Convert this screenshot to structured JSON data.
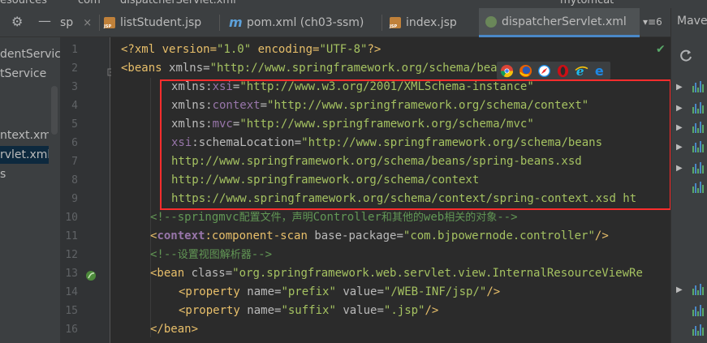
{
  "breadcrumb": {
    "a": "esources",
    "b": "com",
    "c": "dispatcherServlet.xml",
    "run_config": "mytomcat"
  },
  "tabs": [
    {
      "label": "sp",
      "icon": "jsp-file-icon"
    },
    {
      "label": "listStudent.jsp",
      "icon": "jsp-file-icon"
    },
    {
      "label": "pom.xml (ch03-ssm)",
      "icon": "maven-icon"
    },
    {
      "label": "index.jsp",
      "icon": "jsp-file-icon"
    },
    {
      "label": "dispatcherServlet.xml",
      "icon": "xml-file-icon",
      "active": true
    }
  ],
  "tab_overflow": "▾≡6",
  "maven_label": "Mave",
  "project": {
    "items": [
      {
        "label": "dentService"
      },
      {
        "label": "tService"
      },
      {
        "label": "ntext.xml"
      },
      {
        "label": "rvlet.xml",
        "selected": true
      },
      {
        "label": "s"
      }
    ]
  },
  "line_numbers": [
    "1",
    "2",
    "3",
    "4",
    "5",
    "6",
    "7",
    "8",
    "9",
    "10",
    "11",
    "12",
    "13",
    "14",
    "15",
    "16"
  ],
  "code": {
    "l1": {
      "a": "<?xml version=",
      "b": "\"1.0\"",
      "c": " encoding=",
      "d": "\"UTF-8\"",
      "e": "?>"
    },
    "l2": {
      "a": "<beans ",
      "b": "xmlns=",
      "c": "\"http://www.springframework.org/schema/bea"
    },
    "l3": {
      "ns": "xmlns:",
      "ns2": "xsi",
      "eq": "=",
      "val": "\"http://www.w3.org/2001/XMLSchema-instance\""
    },
    "l4": {
      "ns": "xmlns:",
      "ns2": "context",
      "eq": "=",
      "val": "\"http://www.springframework.org/schema/context\""
    },
    "l5": {
      "ns": "xmlns:",
      "ns2": "mvc",
      "eq": "=",
      "val": "\"http://www.springframework.org/schema/mvc\""
    },
    "l6": {
      "ns": "xsi",
      "colon": ":schemaLocation=",
      "val": "\"http://www.springframework.org/schema/beans"
    },
    "l7": {
      "val": "http://www.springframework.org/schema/beans/spring-beans.xsd"
    },
    "l8": {
      "val": "http://www.springframework.org/schema/context"
    },
    "l9": {
      "val": "https://www.springframework.org/schema/context/spring-context.xsd ht"
    },
    "l10": {
      "a": "<!--springmvc",
      "b": "配置文件，声明",
      "c": "Controller",
      "d": "和其他的",
      "e": "web",
      "f": "相关的对象",
      "g": "-->"
    },
    "l11": {
      "a": "<",
      "b": "context",
      "c": ":component-scan ",
      "d": "base-package=",
      "e": "\"com.bjpowernode.controller\"",
      "f": "/>"
    },
    "l12": {
      "a": "<!--",
      "b": "设置视图解析器",
      "c": "-->"
    },
    "l13": {
      "a": "<bean ",
      "b": "class=",
      "c": "\"org.springframework.web.servlet.view.InternalResourceViewRe"
    },
    "l14": {
      "a": "<property ",
      "b": "name=",
      "c": "\"prefix\"",
      "d": " value=",
      "e": "\"/WEB-INF/jsp/\"",
      "f": "/>"
    },
    "l15": {
      "a": "<property ",
      "b": "name=",
      "c": "\"suffix\"",
      "d": " value=",
      "e": "\".jsp\"",
      "f": "/>"
    },
    "l16": {
      "a": "</bean>"
    }
  },
  "browser_icons": [
    "chrome-icon",
    "firefox-icon",
    "safari-icon",
    "opera-icon",
    "ie-icon",
    "edge-icon"
  ],
  "colors": {
    "highlight_box": "#ff2d2d",
    "comment": "#629755",
    "string": "#a5c261",
    "tag": "#e8bf6a",
    "namespace": "#9876aa"
  }
}
